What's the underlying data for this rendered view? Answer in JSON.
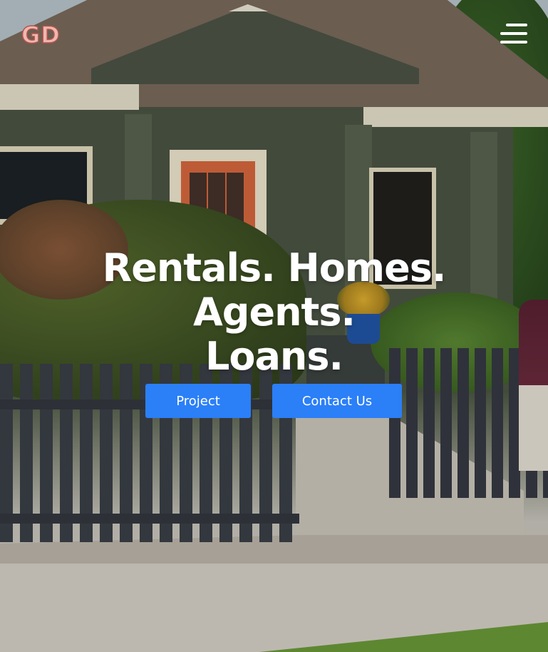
{
  "header": {
    "logo_text": "GD",
    "menu_icon": "hamburger-menu-icon"
  },
  "hero": {
    "headline_line1": "Rentals. Homes. Agents.",
    "headline_line2": "Loans."
  },
  "actions": {
    "project_label": "Project",
    "contact_label": "Contact Us"
  },
  "colors": {
    "button_blue": "#2b7ff7",
    "logo_pink": "#efb7b0",
    "text_white": "#ffffff"
  }
}
